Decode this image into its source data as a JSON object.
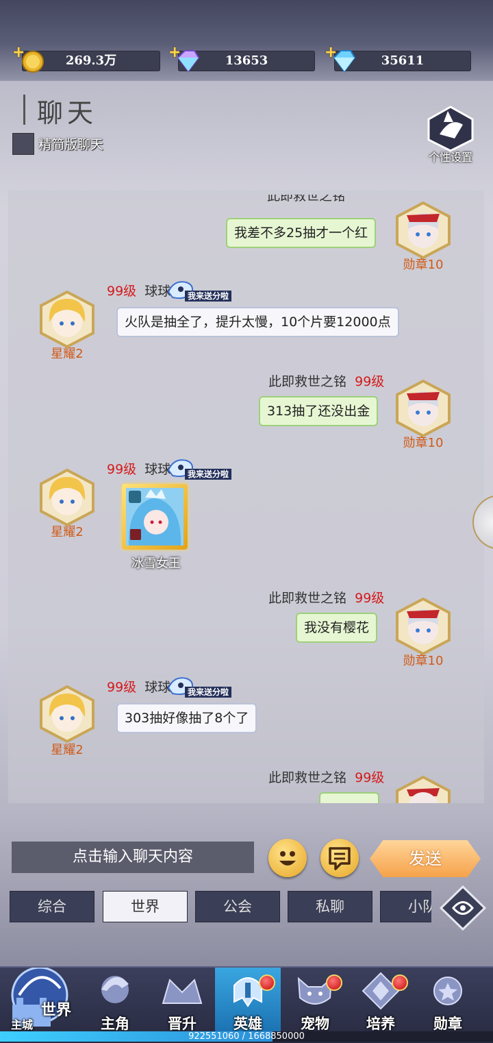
{
  "resources": [
    {
      "name": "gold",
      "value": "269.3万",
      "icon": "gold-coin-icon"
    },
    {
      "name": "crystal",
      "value": "13653",
      "icon": "rainbow-crystal-icon"
    },
    {
      "name": "diamond",
      "value": "35611",
      "icon": "blue-diamond-icon"
    }
  ],
  "header": {
    "title": "聊天",
    "simple_mode_label": "精简版聊天",
    "settings_label": "个性设置"
  },
  "badge_text": "我来送分啦",
  "messages": {
    "m1": {
      "text": "我差不多25抽才一个红",
      "rank": "勋章10"
    },
    "m2": {
      "level": "99级",
      "name": "球球",
      "text": "火队是抽全了，提升太慢，10个片要12000点",
      "rank": "星耀2"
    },
    "m3": {
      "name": "此即救世之铭",
      "level": "99级",
      "text": "313抽了还没出金",
      "rank": "勋章10"
    },
    "m4": {
      "level": "99级",
      "name": "球球",
      "card_label": "冰雪女王",
      "rank": "星耀2"
    },
    "m5": {
      "name": "此即救世之铭",
      "level": "99级",
      "text": "我没有樱花",
      "rank": "勋章10"
    },
    "m6": {
      "level": "99级",
      "name": "球球",
      "text": "303抽好像抽了8个了",
      "rank": "星耀2"
    },
    "m7": {
      "name": "此即救世之铭",
      "level": "99级"
    }
  },
  "input": {
    "placeholder": "点击输入聊天内容"
  },
  "send_label": "发送",
  "tabs": [
    "综合",
    "世界",
    "公会",
    "私聊",
    "小队"
  ],
  "active_tab": "世界",
  "nav": {
    "world_label": "世界",
    "city_label": "主城",
    "items": [
      {
        "label": "主角",
        "icon": "hero-profile-icon"
      },
      {
        "label": "晋升",
        "icon": "promotion-icon"
      },
      {
        "label": "英雄",
        "icon": "helmet-icon"
      },
      {
        "label": "宠物",
        "icon": "pet-icon"
      },
      {
        "label": "培养",
        "icon": "training-icon"
      },
      {
        "label": "勋章",
        "icon": "medal-icon"
      }
    ]
  },
  "progress": {
    "text": "922551060 / 1668850000",
    "fraction": 0.5528
  },
  "colors": {
    "level_red": "#d41a1a",
    "rank_orange": "#d05a16",
    "green_bubble": "#e6f6d2",
    "nav_active": "#2a8dd0"
  }
}
